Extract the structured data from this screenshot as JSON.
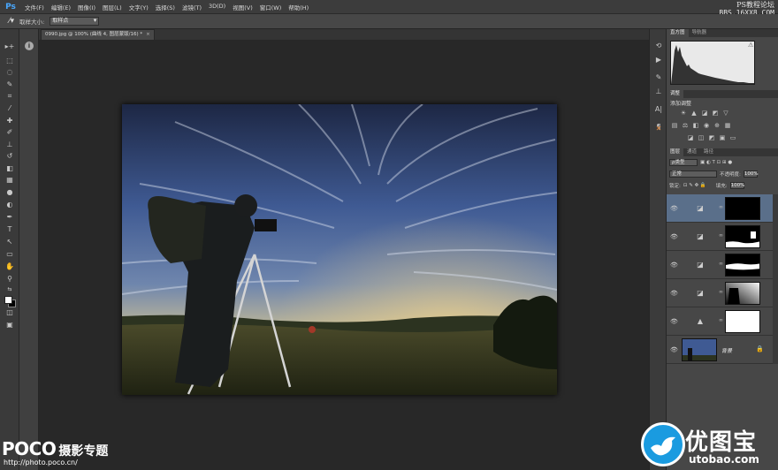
{
  "app": {
    "logo": "Ps"
  },
  "menu": [
    "文件(F)",
    "编辑(E)",
    "图像(I)",
    "图层(L)",
    "文字(Y)",
    "选择(S)",
    "滤镜(T)",
    "3D(D)",
    "视图(V)",
    "窗口(W)",
    "帮助(H)"
  ],
  "watermark_top": {
    "line1": "PS教程论坛",
    "line2": "BBS.16XX8.COM"
  },
  "options": {
    "sample_label": "取样大小:",
    "sample_value": "取样点"
  },
  "document": {
    "tab_title": "0990.jpg @ 100% (曲线 4, 图层蒙版/16) *",
    "close": "×"
  },
  "panels": {
    "histogram_tabs": [
      "直方图",
      "导航器"
    ],
    "adjust_tab": "调整",
    "adjust_title": "添加调整",
    "layer_tabs": [
      "图层",
      "通道",
      "路径"
    ],
    "kind_filter": "ρ类型",
    "blend_mode": "正常",
    "opacity_label": "不透明度:",
    "opacity_value": "100%",
    "lock_label": "锁定:",
    "fill_label": "填充:",
    "fill_value": "100%"
  },
  "layers": [
    {
      "type": "curves",
      "selected": true
    },
    {
      "type": "curves",
      "selected": false
    },
    {
      "type": "curves",
      "selected": false
    },
    {
      "type": "curves",
      "selected": false
    },
    {
      "type": "levels",
      "selected": false
    },
    {
      "type": "background",
      "name": "背景"
    }
  ],
  "bottom_watermarks": {
    "poco_brand": "POCO",
    "poco_topic": "摄影专题",
    "poco_url": "http://photo.poco.cn/",
    "utobao_title": "优图宝",
    "utobao_domain": "utobao.com"
  },
  "colors": {
    "accent": "#49a8ff",
    "selected_layer": "#5a6f8a",
    "utobao_blue": "#1a9be0"
  }
}
